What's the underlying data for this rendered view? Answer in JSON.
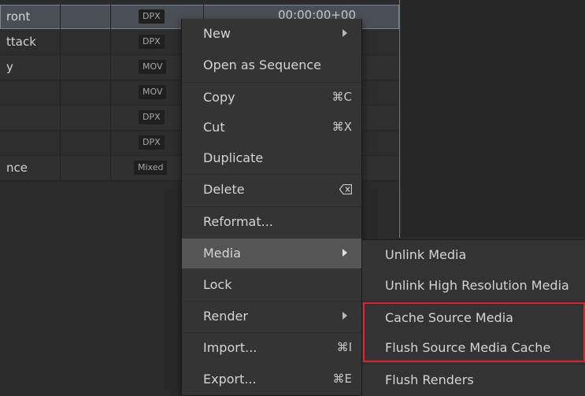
{
  "table": {
    "rows": [
      {
        "name": "ront",
        "format": "DPX",
        "timecode": "00:00:00+00"
      },
      {
        "name": "ttack",
        "format": "DPX",
        "timecode": ""
      },
      {
        "name": "y",
        "format": "MOV",
        "timecode": ""
      },
      {
        "name": "",
        "format": "MOV",
        "timecode": ""
      },
      {
        "name": "",
        "format": "DPX",
        "timecode": ""
      },
      {
        "name": "",
        "format": "DPX",
        "timecode": ""
      },
      {
        "name": "nce",
        "format": "Mixed",
        "timecode": ""
      }
    ]
  },
  "context_menu": {
    "items": [
      {
        "label": "New",
        "shortcut": "",
        "has_submenu": true
      },
      {
        "label": "Open as Sequence",
        "shortcut": ""
      },
      {
        "label": "Copy",
        "shortcut": "⌘C"
      },
      {
        "label": "Cut",
        "shortcut": "⌘X"
      },
      {
        "label": "Duplicate",
        "shortcut": ""
      },
      {
        "label": "Delete",
        "shortcut_icon": "delete-backward-icon"
      },
      {
        "label": "Reformat...",
        "shortcut": ""
      },
      {
        "label": "Media",
        "shortcut": "",
        "has_submenu": true,
        "highlighted": true
      },
      {
        "label": "Lock",
        "shortcut": ""
      },
      {
        "label": "Render",
        "shortcut": "",
        "has_submenu": true
      },
      {
        "label": "Import...",
        "shortcut": "⌘I"
      },
      {
        "label": "Export...",
        "shortcut": "⌘E"
      }
    ]
  },
  "media_submenu": {
    "items": [
      {
        "label": "Unlink Media"
      },
      {
        "label": "Unlink High Resolution Media"
      },
      {
        "label": "Cache Source Media"
      },
      {
        "label": "Flush Source Media Cache"
      },
      {
        "label": "Flush Renders"
      }
    ],
    "annotation_color": "#e0232b"
  },
  "colors": {
    "background": "#2b2b2b",
    "menu_background": "#343434",
    "menu_highlight": "#555555",
    "annotation": "#e0232b"
  }
}
